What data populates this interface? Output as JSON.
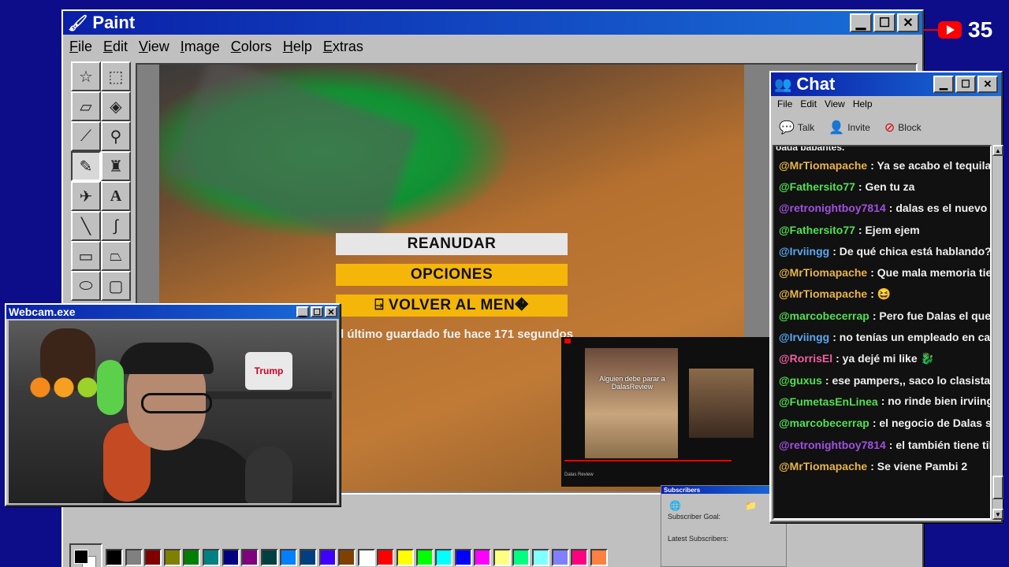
{
  "paint": {
    "title": "Paint",
    "menu": [
      "File",
      "Edit",
      "View",
      "Image",
      "Colors",
      "Help",
      "Extras"
    ],
    "palette": [
      "#000000",
      "#808080",
      "#800000",
      "#808000",
      "#008000",
      "#008080",
      "#000080",
      "#800080",
      "#004040",
      "#0080ff",
      "#004080",
      "#4000ff",
      "#804000",
      "#ffffff",
      "#ff0000",
      "#ffff00",
      "#00ff00",
      "#00ffff",
      "#0000ff",
      "#ff00ff",
      "#ffff80",
      "#00ff80",
      "#80ffff",
      "#8080ff",
      "#ff0080",
      "#ff8040"
    ]
  },
  "game": {
    "resume": "REANUDAR",
    "options": "OPCIONES",
    "main_menu": "⍈ VOLVER AL MEN�",
    "save_note": "l último guardado fue hace 171 segundos"
  },
  "webcam": {
    "title": "Webcam.exe",
    "poster_text": "Trump"
  },
  "youtube": {
    "caption": "Alguien debe parar a DalasReview",
    "channel": "Dalas Review"
  },
  "subscribers": {
    "title": "Subscribers",
    "goal": "Subscriber Goal:",
    "latest": "Latest Subscribers:"
  },
  "counter": {
    "value": "35"
  },
  "chat": {
    "title": "Chat",
    "menu": [
      "File",
      "Edit",
      "View",
      "Help"
    ],
    "tools": [
      {
        "icon": "talk-icon",
        "label": "Talk"
      },
      {
        "icon": "invite-icon",
        "label": "Invite"
      },
      {
        "icon": "block-icon",
        "label": "Block"
      }
    ],
    "partial_top": "oada babantes.",
    "messages": [
      {
        "user": "@MrTiomapache",
        "color": "#e8b44a",
        "text": ": Ya se acabo el tequila"
      },
      {
        "user": "@Fathersito77",
        "color": "#52e052",
        "text": ": Gen tu za"
      },
      {
        "user": "@retronightboy7814",
        "color": "#a050e0",
        "text": ": dalas es el nuevo Sh"
      },
      {
        "user": "@Fathersito77",
        "color": "#52e052",
        "text": ": Ejem ejem"
      },
      {
        "user": "@Irviingg",
        "color": "#5aa8f0",
        "text": ": De qué chica está hablando?"
      },
      {
        "user": "@MrTiomapache",
        "color": "#e8b44a",
        "text": ": Que mala memoria tiene"
      },
      {
        "user": "@MrTiomapache",
        "color": "#e8b44a",
        "text": ": 😆"
      },
      {
        "user": "@marcobecerrap",
        "color": "#52e052",
        "text": ": Pero fue Dalas el que le r"
      },
      {
        "user": "@Irviingg",
        "color": "#5aa8f0",
        "text": ": no tenías un empleado en caja qu"
      },
      {
        "user": "@RorrisEl",
        "color": "#f060a0",
        "text": ": ya dejé mi like 🐉"
      },
      {
        "user": "@guxus",
        "color": "#52e052",
        "text": ": ese pampers,, saco lo clasista"
      },
      {
        "user": "@FumetasEnLinea",
        "color": "#52e052",
        "text": ": no rinde bien irviing 😆"
      },
      {
        "user": "@marcobecerrap",
        "color": "#52e052",
        "text": ": el negocio de Dalas son l"
      },
      {
        "user": "@retronightboy7814",
        "color": "#a050e0",
        "text": ": el también tiene tikto"
      },
      {
        "user": "@MrTiomapache",
        "color": "#e8b44a",
        "text": ": Se viene Pambi 2"
      }
    ]
  }
}
